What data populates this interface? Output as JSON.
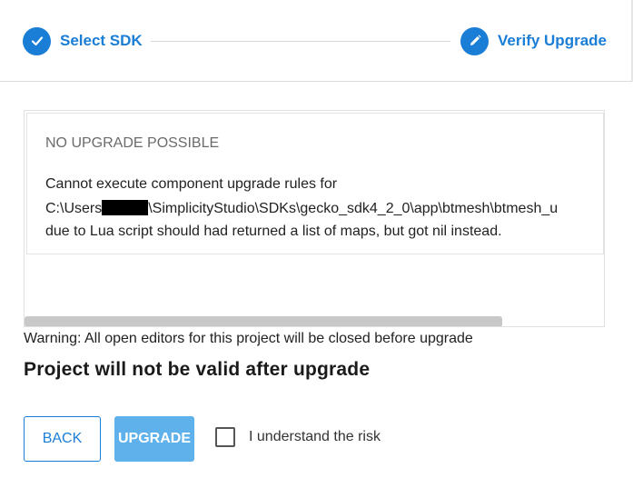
{
  "stepper": {
    "steps": [
      {
        "label": "Select SDK",
        "icon": "check-icon",
        "state": "complete"
      },
      {
        "label": "Verify Upgrade",
        "icon": "pencil-icon",
        "state": "active"
      }
    ]
  },
  "message": {
    "title": "NO UPGRADE POSSIBLE",
    "line1": "Cannot execute component upgrade rules for",
    "path_prefix": "C:\\Users",
    "path_suffix": "\\SimplicityStudio\\SDKs\\gecko_sdk4_2_0\\app\\btmesh\\btmesh_u",
    "line3": "due to Lua script should had returned a list of maps, but got nil instead."
  },
  "warning": "Warning: All open editors for this project will be closed before upgrade",
  "invalid_heading": "Project will not be valid after upgrade",
  "footer": {
    "back_label": "BACK",
    "upgrade_label": "UPGRADE",
    "risk_label": "I understand the risk",
    "risk_checked": false
  },
  "colors": {
    "accent": "#1a7dd6",
    "upgrade_disabled": "#5eb1ea",
    "scroll_thumb": "#c8c8c8"
  }
}
